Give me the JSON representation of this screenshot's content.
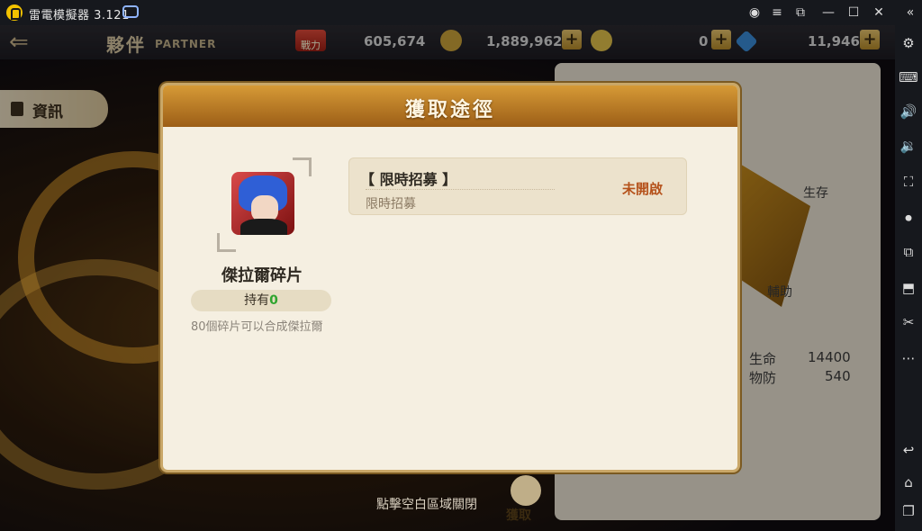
{
  "emulator": {
    "app_name": "雷電模擬器 3.121",
    "toolbar_icons": [
      "account-icon",
      "menu-icon",
      "restore-icon",
      "minimize-icon",
      "maximize-icon",
      "close-icon",
      "collapse-icon"
    ],
    "side_icons": [
      "settings-icon",
      "keyboard-icon",
      "volume-up-icon",
      "volume-down-icon",
      "screenshot-icon",
      "record-icon",
      "multi-instance-icon",
      "apk-install-icon",
      "cut-icon",
      "more-icon",
      "back-icon",
      "home-icon",
      "recent-apps-icon"
    ]
  },
  "game": {
    "header": {
      "title": "夥伴",
      "subtitle": "PARTNER",
      "power_label": "戰力",
      "power_value": "605,674",
      "gold_value": "1,889,962",
      "gem_value": "0",
      "diamond_value": "11,946"
    },
    "left_tab": "資訊",
    "stats": {
      "hp_label": "生命",
      "hp_value": "14400",
      "pdef_label": "物防",
      "pdef_value": "540",
      "radar_survive": "生存",
      "radar_support": "輔助"
    },
    "close_hint": "點擊空白區域關閉",
    "get_label": "獲取"
  },
  "modal": {
    "title": "獲取途徑",
    "fragment_name": "傑拉爾碎片",
    "owned_label": "持有",
    "owned_count": "0",
    "description": "80個碎片可以合成傑拉爾",
    "sources": [
      {
        "name": "【 限時招募 】",
        "sub": "限時招募",
        "status": "未開啟"
      }
    ]
  },
  "colors": {
    "accent": "#c9a768",
    "status_closed": "#b5521b",
    "owned_count": "#2fa52f"
  }
}
